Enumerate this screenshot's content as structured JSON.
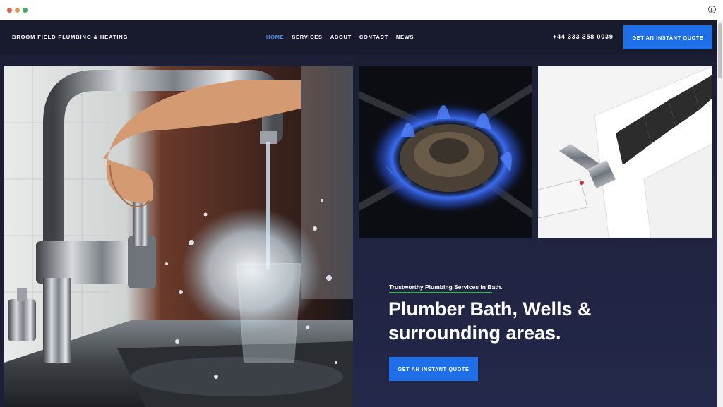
{
  "browser": {
    "icons": {
      "download": "download-icon"
    },
    "colors": {
      "close": "#e0604f",
      "minimize": "#d79a55",
      "maximize": "#43a85b"
    }
  },
  "header": {
    "brand": "BROOM FIELD PLUMBING & HEATING",
    "nav": [
      {
        "label": "HOME",
        "active": true
      },
      {
        "label": "SERVICES",
        "active": false
      },
      {
        "label": "ABOUT",
        "active": false
      },
      {
        "label": "CONTACT",
        "active": false
      },
      {
        "label": "NEWS",
        "active": false
      }
    ],
    "phone": "+44 333 358 0039",
    "cta_label": "GET AN INSTANT QUOTE"
  },
  "hero": {
    "eyebrow": "Trustworthy Plumbing Services in Bath.",
    "headline": "Plumber Bath, Wells & surrounding areas.",
    "cta_label": "GET AN INSTANT QUOTE",
    "images": [
      "tap-water-photo",
      "gas-burner-photo",
      "radiator-valve-photo"
    ]
  },
  "colors": {
    "accent": "#1e6fe8",
    "active_nav": "#4d8ff0",
    "underline": "#3fae5b",
    "header_bg": "#181b2d",
    "hero_bg": "#1c1f35"
  }
}
